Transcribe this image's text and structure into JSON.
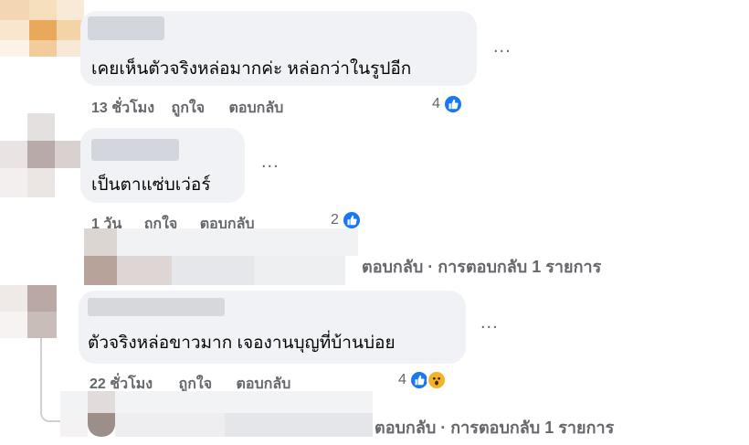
{
  "colors": {
    "bubble": "#f0f2f5",
    "meta": "#65676b",
    "like": "#1877f2",
    "wow": "#f7b125"
  },
  "comments": [
    {
      "text": "เคยเห็นตัวจริงหล่อมากค่ะ หล่อกว่าในรูปอีก",
      "time": "13 ชั่วโมง",
      "like_label": "ถูกใจ",
      "reply_label": "ตอบกลับ",
      "reaction_count": "4",
      "reactions": [
        "like-icon"
      ],
      "more": "..."
    },
    {
      "text": "เป็นตาแซ่บเว่อร์",
      "time": "1 วัน",
      "like_label": "ถูกใจ",
      "reply_label": "ตอบกลับ",
      "reaction_count": "2",
      "reactions": [
        "like-icon"
      ],
      "more": "...",
      "replies_summary": "ตอบกลับ · การตอบกลับ 1 รายการ"
    },
    {
      "text": "ตัวจริงหล่อขาวมาก เจองานบุญที่บ้านบ่อย",
      "time": "22 ชั่วโมง",
      "like_label": "ถูกใจ",
      "reply_label": "ตอบกลับ",
      "reaction_count": "4",
      "reactions": [
        "like-icon",
        "wow-icon"
      ],
      "more": "...",
      "replies_summary": "ตอบกลับ · การตอบกลับ 1 รายการ"
    }
  ]
}
